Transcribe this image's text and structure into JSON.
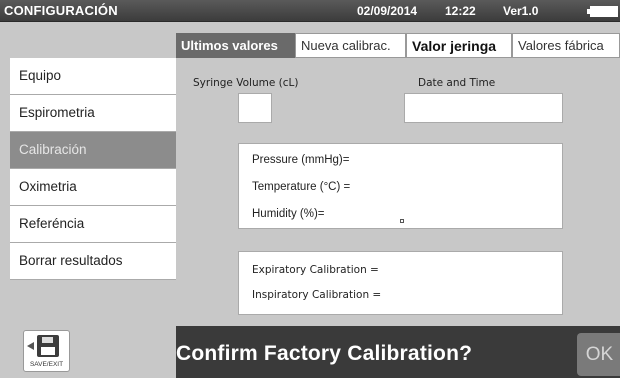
{
  "header": {
    "title": "CONFIGURACIÓN",
    "date": "02/09/2014",
    "time": "12:22",
    "version": "Ver1.0",
    "battery_icon": "battery-icon"
  },
  "tabs": [
    {
      "label": "Ultimos valores",
      "active": true
    },
    {
      "label": "Nueva calibrac.",
      "active": false
    },
    {
      "label": "Valor jeringa",
      "active": false
    },
    {
      "label": "Valores fábrica",
      "active": false
    }
  ],
  "sidebar": {
    "items": [
      {
        "label": "Equipo",
        "active": false
      },
      {
        "label": "Espirometria",
        "active": false
      },
      {
        "label": "Calibración",
        "active": true
      },
      {
        "label": "Oximetria",
        "active": false
      },
      {
        "label": "Referéncia",
        "active": false
      },
      {
        "label": "Borrar resultados",
        "active": false
      }
    ]
  },
  "fields": {
    "syringe_volume_label": "Syringe Volume (cL)",
    "syringe_volume_value": "",
    "date_time_label": "Date and Time",
    "date_time_value": ""
  },
  "environment": {
    "pressure": "Pressure (mmHg)=",
    "temperature": "Temperature (°C) =",
    "humidity": "Humidity (%)="
  },
  "calibration": {
    "expiratory": "Expiratory Calibration =",
    "inspiratory": "Inspiratory Calibration ="
  },
  "footer": {
    "save_exit_label": "SAVE/EXIT",
    "save_exit_icon": "floppy-disk-icon",
    "confirm_text": "Confirm Factory Calibration?",
    "ok_label": "OK"
  },
  "colors": {
    "title_bar": "#3c3c3c",
    "active_tab": "#6a6a6a",
    "active_sidebar": "#8c8c8c",
    "confirm_bar": "#3a3a3a",
    "ok_button": "#7a7a7a"
  }
}
